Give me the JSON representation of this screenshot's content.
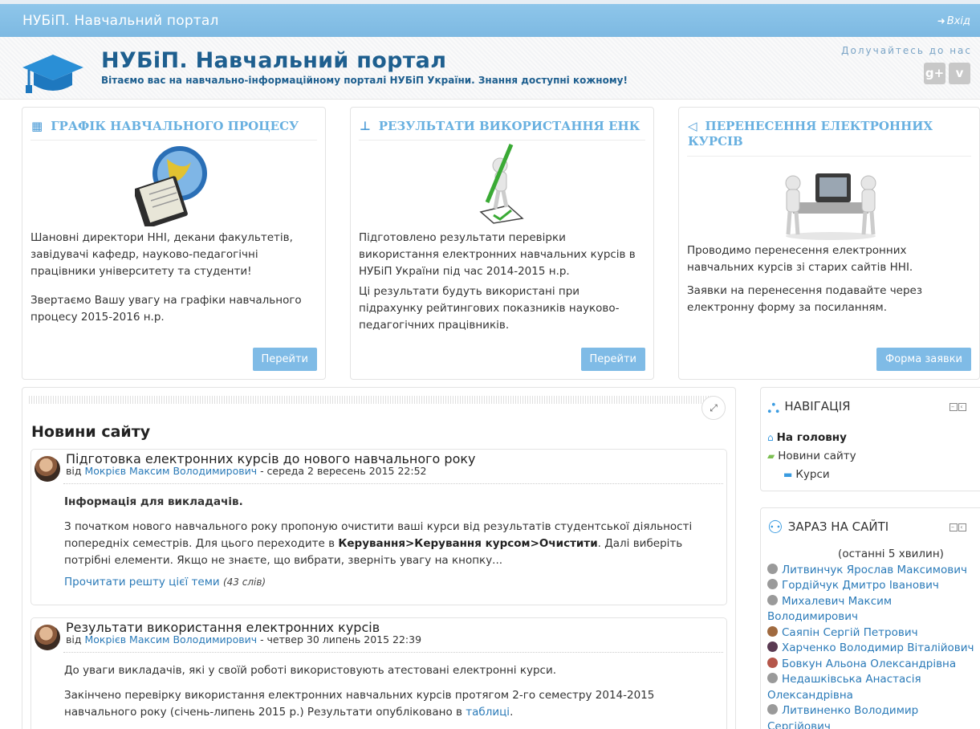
{
  "navbar": {
    "brand": "НУБіП. Навчальний портал",
    "login": "Вхід"
  },
  "header": {
    "title": "НУБіП. Навчальний портал",
    "subtitle": "Вітаємо вас на навчально-інформаційному порталі НУБіП України. Знання доступні кожному!",
    "join": "Долучайтесь до нас",
    "social": [
      "g+",
      "v"
    ]
  },
  "features": [
    {
      "title": "ГРАФІК НАВЧАЛЬНОГО ПРОЦЕСУ",
      "p1": "Шановні директори ННІ, декани факультетів, завідувачі кафедр, науково-педагогічні працівники університету та студенти!",
      "p2": "Звертаємо Вашу увагу на графіки навчального процесу 2015-2016 н.р.",
      "button": "Перейти"
    },
    {
      "title": "РЕЗУЛЬТАТИ ВИКОРИСТАННЯ ЕНК",
      "p1": "Підготовлено результати перевірки використання електронних навчальних курсів в НУБіП України під час 2014-2015 н.р.",
      "p2": "Ці результати будуть використані при підрахунку рейтингових показників науково- педагогічних працівників.",
      "button": "Перейти"
    },
    {
      "title": "ПЕРЕНЕСЕННЯ ЕЛЕКТРОННИХ КУРСІВ",
      "p1": "Проводимо перенесення електронних навчальних курсів зі старих сайтів ННІ.",
      "p2": "Заявки на перенесення подавайте через електронну форму за посиланням.",
      "button": "Форма заявки"
    }
  ],
  "news": {
    "heading": "Новини сайту",
    "posts": [
      {
        "title": "Підготовка електронних курсів до нового навчального року",
        "by": "від",
        "author": "Мокрієв Максим Володимирович",
        "date": " - середа 2 вересень 2015 22:52",
        "lead": "Інформація для викладачів.",
        "text_a": "З початком нового навчального року пропоную очистити ваші курси від результатів студентської діяльності попередніх семестрів. Для цього переходите в ",
        "text_bold": "Керування>Керування курсом>Очистити",
        "text_b": ". Далі виберіть потрібні елементи. Якщо не знаєте, що вибрати, зверніть увагу на кнопку...",
        "readmore": "Прочитати решту цієї теми",
        "words": "(43 слів)"
      },
      {
        "title": "Результати використання електронних курсів",
        "by": "від",
        "author": "Мокрієв Максим Володимирович",
        "date": " - четвер 30 липень 2015 22:39",
        "p1": "До уваги викладачів, які у своїй роботі використовують атестовані електронні курси.",
        "p2": "Закінчено перевірку використання електронних навчальних курсів протягом 2-го семестру 2014-2015 навчального року (січень-липень 2015 р.) Результати опубліковано в ",
        "p2_link": "таблиці",
        "p2_end": "."
      }
    ]
  },
  "navigation": {
    "title": "НАВІГАЦІЯ",
    "home": "На головну",
    "site_news": "Новини сайту",
    "courses": "Курси"
  },
  "online": {
    "title": "ЗАРАЗ НА САЙТІ",
    "note": "(останні 5 хвилин)",
    "users": [
      "Литвинчук Ярослав Максимович",
      "Гордійчук Дмитро Іванович",
      "Михалевич Максим Володимирович",
      "Саяпін Сергій Петрович",
      "Харченко Володимир Віталійович",
      "Бовкун Альона Олександрівна",
      "Недашківська Анастасія Олександрівна",
      "Литвиненко Володимир Сергійович"
    ]
  },
  "colors": {
    "navbar": "#7db9e2",
    "accent": "#68b0e0",
    "title": "#1e5f8f",
    "button": "#7fbbe6",
    "link": "#2a7ab8"
  }
}
